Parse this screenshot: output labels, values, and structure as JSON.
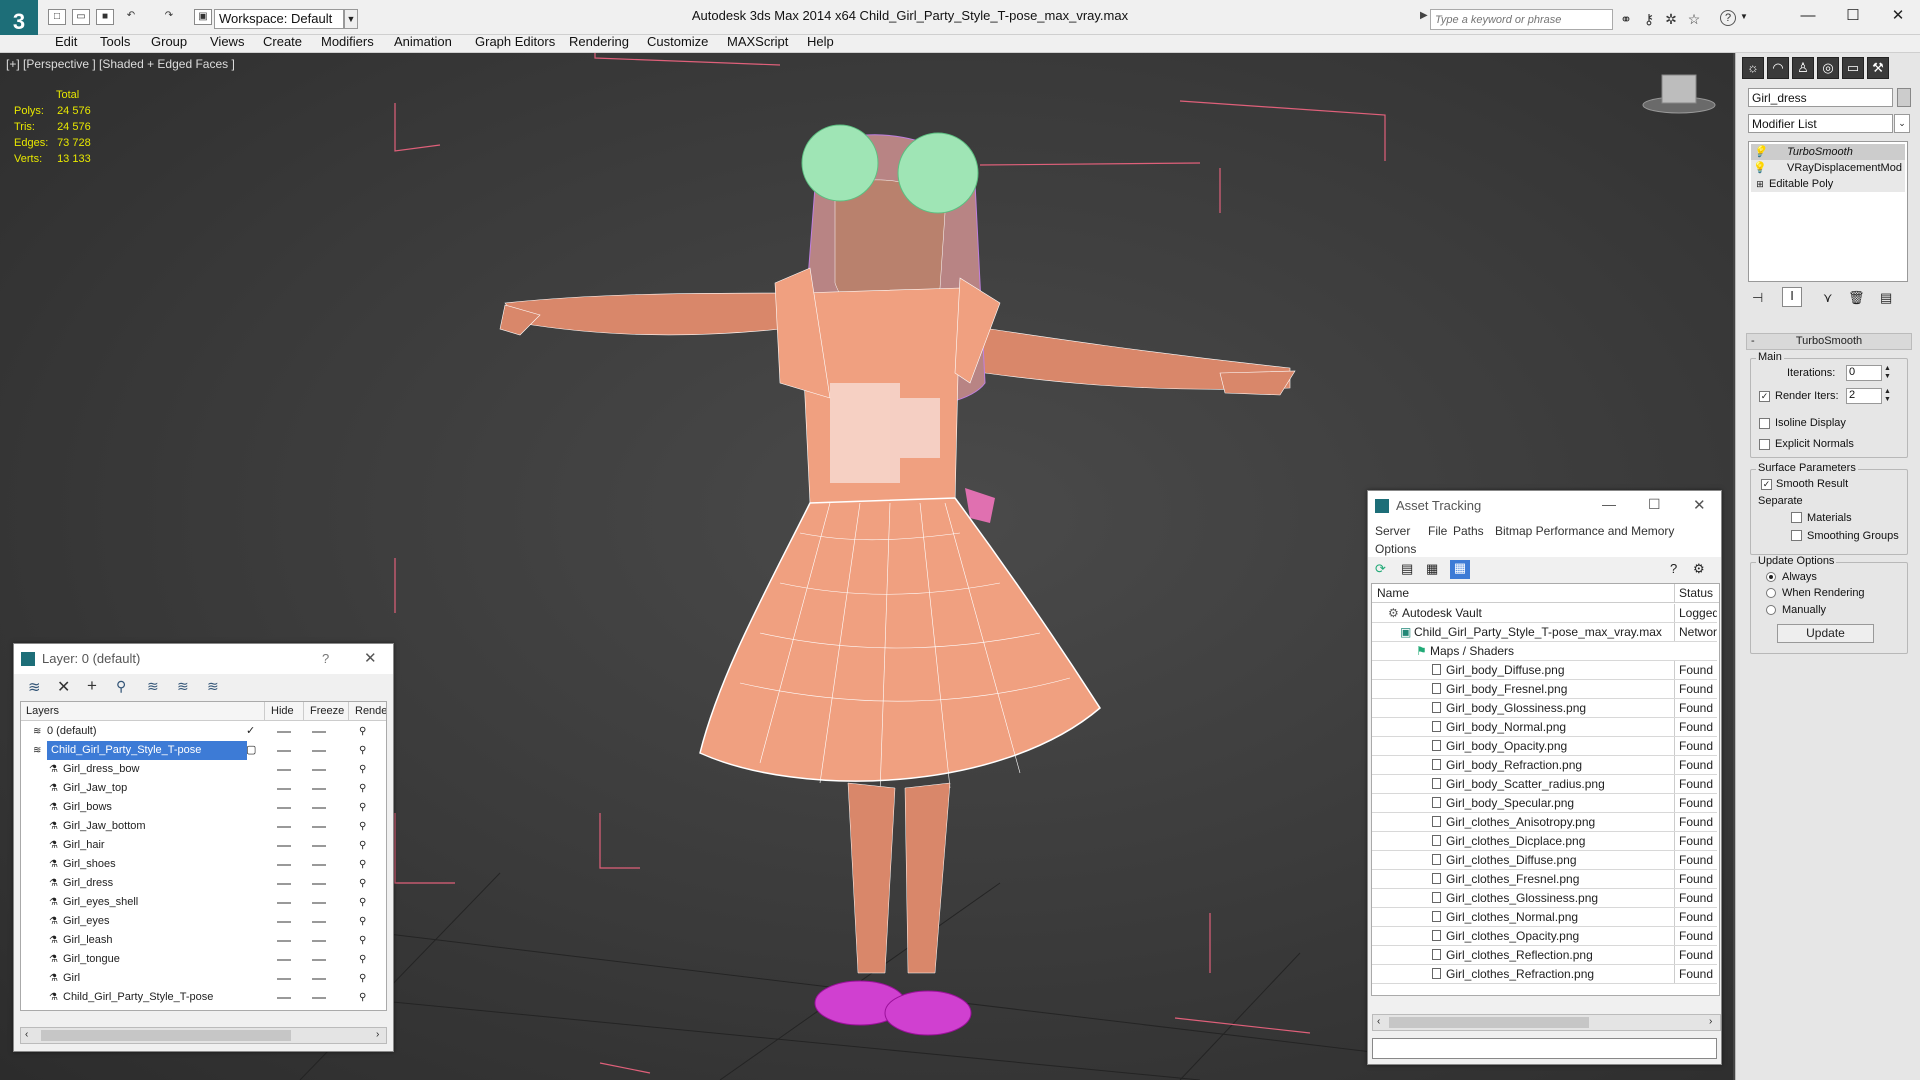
{
  "app": {
    "title": "Autodesk 3ds Max  2014 x64     Child_Girl_Party_Style_T-pose_max_vray.max",
    "logo": "3",
    "workspace": "Workspace: Default",
    "search_placeholder": "Type a keyword or phrase",
    "window_controls": [
      "minimize-icon",
      "maximize-icon",
      "close-icon"
    ]
  },
  "menu": [
    "Edit",
    "Tools",
    "Group",
    "Views",
    "Create",
    "Modifiers",
    "Animation",
    "Graph Editors",
    "Rendering",
    "Customize",
    "MAXScript",
    "Help"
  ],
  "viewport": {
    "label": "[+] [Perspective ] [Shaded + Edged Faces ]",
    "stats": {
      "header": "Total",
      "rows": [
        {
          "key": "Polys:",
          "value": "24 576"
        },
        {
          "key": "Tris:",
          "value": "24 576"
        },
        {
          "key": "Edges:",
          "value": "73 728"
        },
        {
          "key": "Verts:",
          "value": "13 133"
        }
      ]
    },
    "colors": {
      "bbox": "#e0607a",
      "skin": "#d9876a",
      "dress": "#f0a080",
      "wire": "#ffffff",
      "hair_wire": "#c080e0",
      "bows": "#9fe5b5",
      "shoes": "#c020c0",
      "stats": "#e8e800"
    }
  },
  "command_panel": {
    "object_name": "Girl_dress",
    "modifier_list": "Modifier List",
    "stack": [
      "TurboSmooth",
      "VRayDisplacementMod",
      "Editable Poly"
    ],
    "rollout_title": "TurboSmooth",
    "main_label": "Main",
    "iterations_label": "Iterations:",
    "iterations_value": "0",
    "render_iters_label": "Render Iters:",
    "render_iters_value": "2",
    "isoline": "Isoline Display",
    "explicit_normals": "Explicit Normals",
    "surface_params": "Surface Parameters",
    "smooth_result": "Smooth Result",
    "separate": "Separate",
    "materials": "Materials",
    "smoothing_groups": "Smoothing Groups",
    "update_options": "Update Options",
    "always": "Always",
    "when_rendering": "When Rendering",
    "manually": "Manually",
    "update_button": "Update"
  },
  "layer_dialog": {
    "title": "Layer: 0 (default)",
    "help": "?",
    "columns": [
      "Layers",
      "Hide",
      "Freeze",
      "Rende"
    ],
    "layers": [
      {
        "name": "0 (default)",
        "indent": 0
      },
      {
        "name": "Child_Girl_Party_Style_T-pose",
        "indent": 0,
        "selected": true
      },
      {
        "name": "Girl_dress_bow",
        "indent": 1
      },
      {
        "name": "Girl_Jaw_top",
        "indent": 1
      },
      {
        "name": "Girl_bows",
        "indent": 1
      },
      {
        "name": "Girl_Jaw_bottom",
        "indent": 1
      },
      {
        "name": "Girl_hair",
        "indent": 1
      },
      {
        "name": "Girl_shoes",
        "indent": 1
      },
      {
        "name": "Girl_dress",
        "indent": 1
      },
      {
        "name": "Girl_eyes_shell",
        "indent": 1
      },
      {
        "name": "Girl_eyes",
        "indent": 1
      },
      {
        "name": "Girl_leash",
        "indent": 1
      },
      {
        "name": "Girl_tongue",
        "indent": 1
      },
      {
        "name": "Girl",
        "indent": 1
      },
      {
        "name": "Child_Girl_Party_Style_T-pose",
        "indent": 1
      }
    ]
  },
  "asset_dialog": {
    "title": "Asset Tracking",
    "menu": [
      "Server",
      "File",
      "Paths",
      "Bitmap Performance and Memory",
      "Options"
    ],
    "columns": [
      "Name",
      "Status"
    ],
    "rows": [
      {
        "name": "Autodesk Vault",
        "status": "Logged Out",
        "indent": 0
      },
      {
        "name": "Child_Girl_Party_Style_T-pose_max_vray.max",
        "status": "Network",
        "indent": 1
      },
      {
        "name": "Maps / Shaders",
        "status": "",
        "indent": 2
      },
      {
        "name": "Girl_body_Diffuse.png",
        "status": "Found",
        "indent": 3
      },
      {
        "name": "Girl_body_Fresnel.png",
        "status": "Found",
        "indent": 3
      },
      {
        "name": "Girl_body_Glossiness.png",
        "status": "Found",
        "indent": 3
      },
      {
        "name": "Girl_body_Normal.png",
        "status": "Found",
        "indent": 3
      },
      {
        "name": "Girl_body_Opacity.png",
        "status": "Found",
        "indent": 3
      },
      {
        "name": "Girl_body_Refraction.png",
        "status": "Found",
        "indent": 3
      },
      {
        "name": "Girl_body_Scatter_radius.png",
        "status": "Found",
        "indent": 3
      },
      {
        "name": "Girl_body_Specular.png",
        "status": "Found",
        "indent": 3
      },
      {
        "name": "Girl_clothes_Anisotropy.png",
        "status": "Found",
        "indent": 3
      },
      {
        "name": "Girl_clothes_Dicplace.png",
        "status": "Found",
        "indent": 3
      },
      {
        "name": "Girl_clothes_Diffuse.png",
        "status": "Found",
        "indent": 3
      },
      {
        "name": "Girl_clothes_Fresnel.png",
        "status": "Found",
        "indent": 3
      },
      {
        "name": "Girl_clothes_Glossiness.png",
        "status": "Found",
        "indent": 3
      },
      {
        "name": "Girl_clothes_Normal.png",
        "status": "Found",
        "indent": 3
      },
      {
        "name": "Girl_clothes_Opacity.png",
        "status": "Found",
        "indent": 3
      },
      {
        "name": "Girl_clothes_Reflection.png",
        "status": "Found",
        "indent": 3
      },
      {
        "name": "Girl_clothes_Refraction.png",
        "status": "Found",
        "indent": 3
      }
    ]
  }
}
